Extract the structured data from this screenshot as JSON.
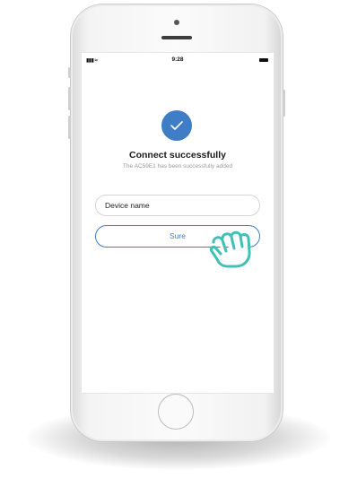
{
  "status_bar": {
    "time": "9:28"
  },
  "success": {
    "title": "Connect successfully",
    "message": "The AC59E1 has been successfully added",
    "icon": "check-icon",
    "accent_color": "#3f7ec6"
  },
  "form": {
    "device_name_value": "Device name",
    "sure_label": "Sure"
  },
  "colors": {
    "accent": "#3f7ec6",
    "hand_outline": "#3fc1b8"
  }
}
